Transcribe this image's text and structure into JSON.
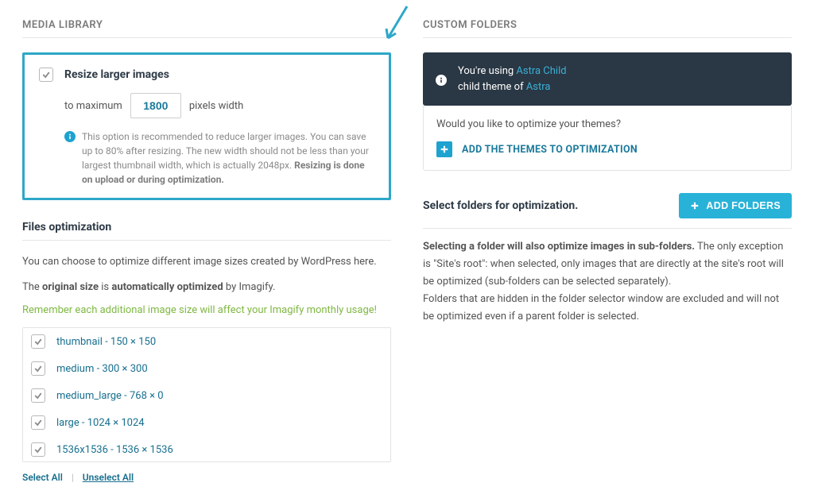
{
  "left": {
    "section_title": "MEDIA LIBRARY",
    "resize": {
      "title": "Resize larger images",
      "prefix": "to maximum",
      "value": "1800",
      "suffix": "pixels width",
      "info_part1": "This option is recommended to reduce larger images. You can save up to 80% after resizing. The new width should not be less than your largest thumbnail width, which is actually 2048px. ",
      "info_bold": "Resizing is done on upload or during optimization."
    },
    "files": {
      "title": "Files optimization",
      "desc_pre": "You can choose to optimize different image sizes created by WordPress here.",
      "desc2_pre": "The ",
      "desc2_b1": "original size",
      "desc2_mid": " is ",
      "desc2_b2": "automatically optimized",
      "desc2_post": " by Imagify.",
      "green": "Remember each additional image size will affect your Imagify monthly usage!",
      "sizes": [
        "thumbnail - 150 × 150",
        "medium - 300 × 300",
        "medium_large - 768 × 0",
        "large - 1024 × 1024",
        "1536x1536 - 1536 × 1536"
      ],
      "select_all": "Select All",
      "unselect_all": "Unselect All"
    }
  },
  "right": {
    "section_title": "CUSTOM FOLDERS",
    "banner": {
      "line1_pre": "You're using ",
      "parent_theme": "Astra Child",
      "line2_pre": "child theme of ",
      "child_of": "Astra"
    },
    "theme_question": "Would you like to optimize your themes?",
    "add_themes_label": "ADD THE THEMES TO OPTIMIZATION",
    "folders_title": "Select folders for optimization.",
    "add_folders_label": "ADD FOLDERS",
    "folders_desc_bold": "Selecting a folder will also optimize images in sub-folders.",
    "folders_desc_rest": " The only exception is \"Site's root\": when selected, only images that are directly at the site's root will be optimized (sub-folders can be selected separately).",
    "folders_desc_p2": "Folders that are hidden in the folder selector window are excluded and will not be optimized even if a parent folder is selected."
  }
}
